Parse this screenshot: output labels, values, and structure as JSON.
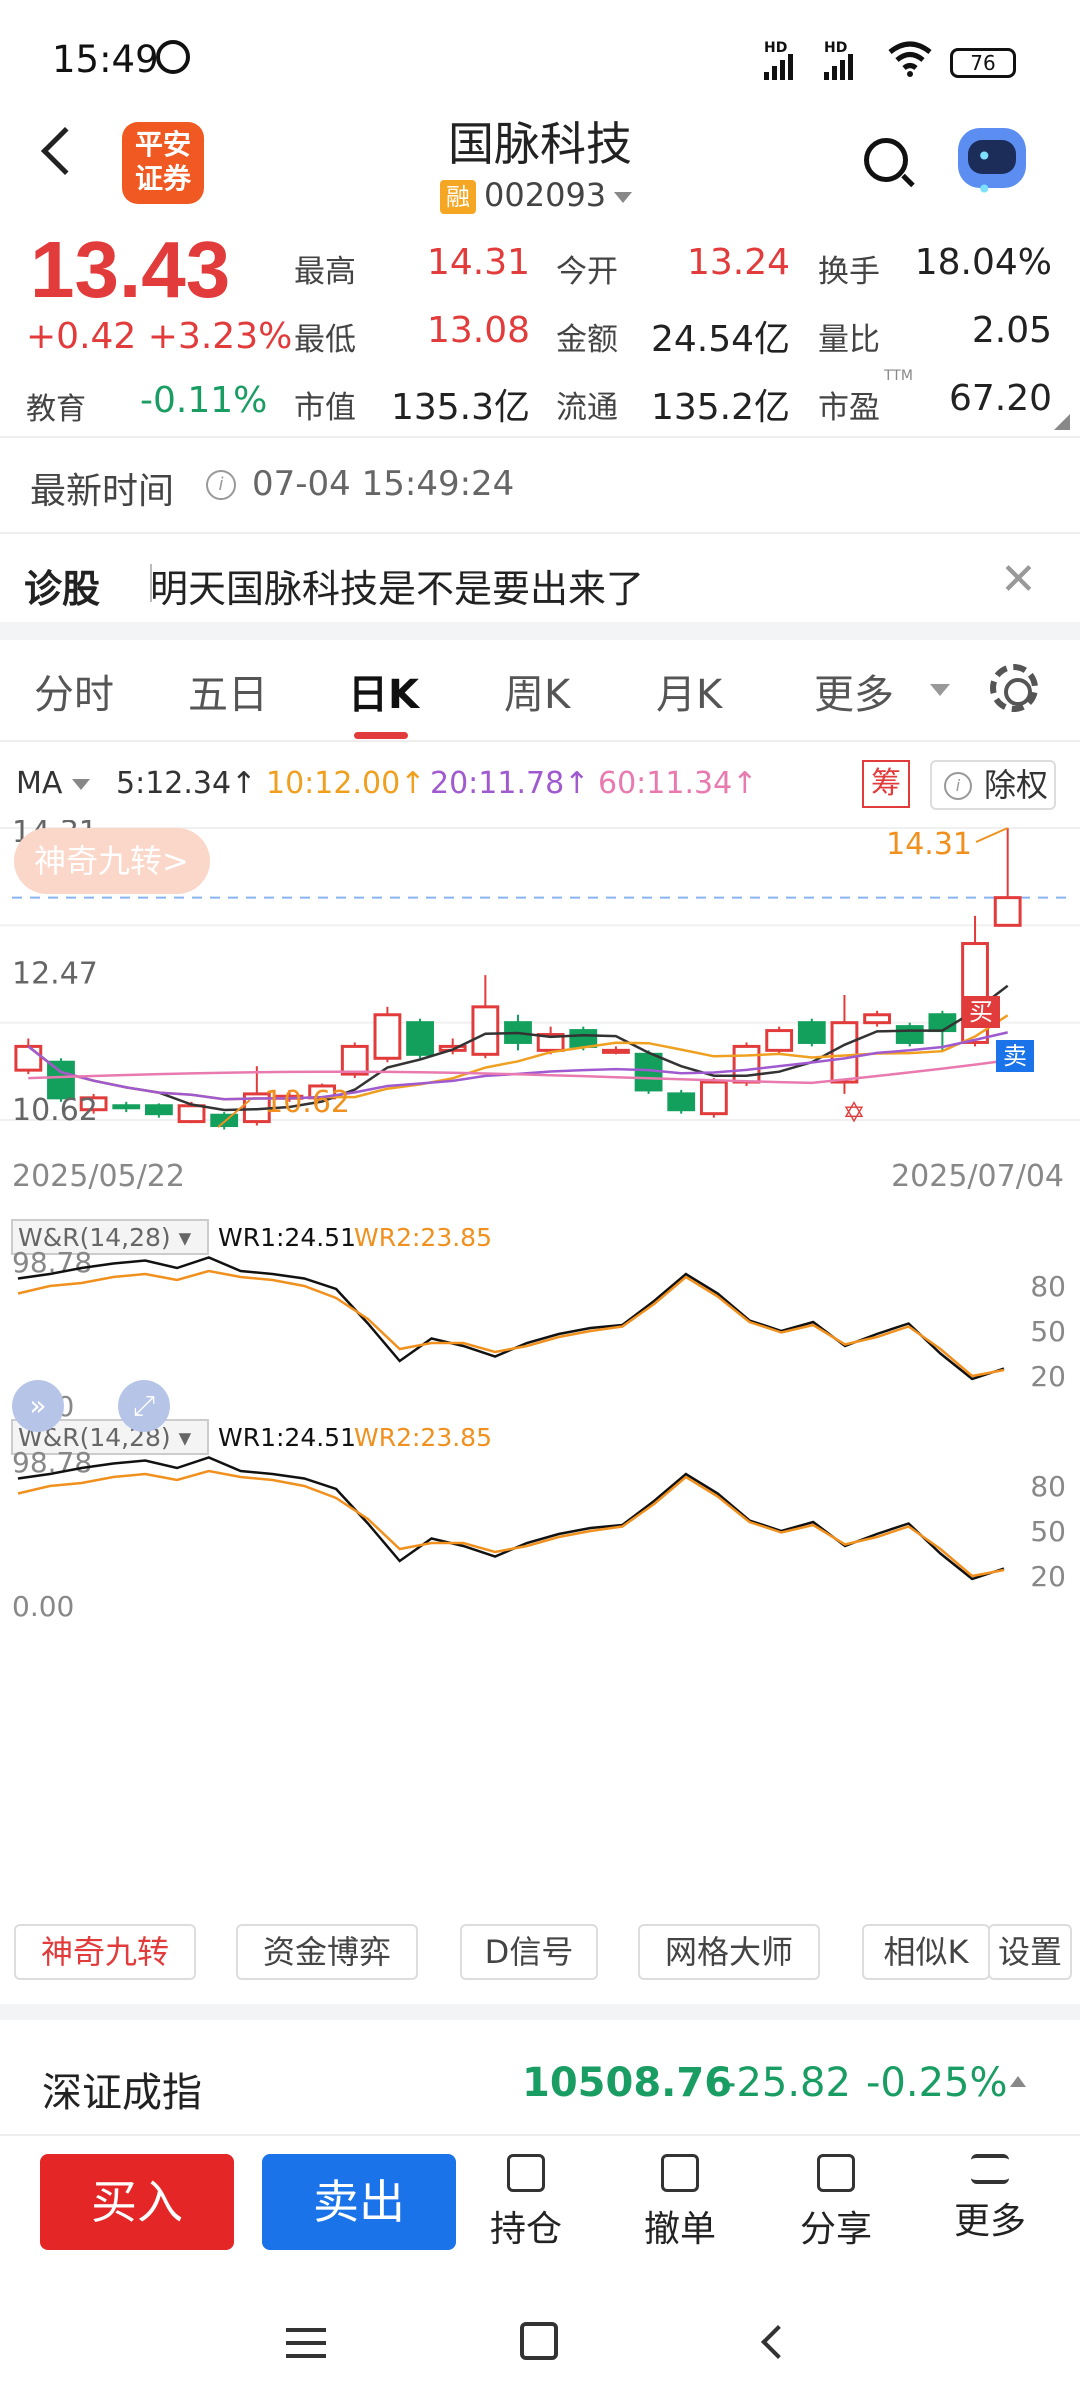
{
  "status_bar": {
    "time": "15:49",
    "battery": "76",
    "hd1": "HD",
    "hd2": "HD"
  },
  "header": {
    "logo_line1": "平安",
    "logo_line2": "证券",
    "stock_name": "国脉科技",
    "rong_badge": "融",
    "stock_code": "002093"
  },
  "quote": {
    "price": "13.43",
    "change": "+0.42",
    "change_pct": "+3.23%",
    "sector_name": "教育",
    "sector_pct": "-0.11%",
    "fields": [
      {
        "label": "最高",
        "value": "14.31",
        "color": "#e23b3b"
      },
      {
        "label": "今开",
        "value": "13.24",
        "color": "#e23b3b"
      },
      {
        "label": "换手",
        "value": "18.04%",
        "color": "#222222"
      },
      {
        "label": "最低",
        "value": "13.08",
        "color": "#e23b3b"
      },
      {
        "label": "金额",
        "value": "24.54亿",
        "color": "#222222"
      },
      {
        "label": "量比",
        "value": "2.05",
        "color": "#222222"
      },
      {
        "label": "市值",
        "value": "135.3亿",
        "color": "#222222"
      },
      {
        "label": "流通",
        "value": "135.2亿",
        "color": "#222222"
      },
      {
        "label": "市盈",
        "value": "67.20",
        "color": "#222222"
      }
    ],
    "ttm": "TTM"
  },
  "latest_time": {
    "label": "最新时间",
    "value": "07-04 15:49:24"
  },
  "diagnosis": {
    "label": "诊股",
    "text": "明天国脉科技是不是要出来了"
  },
  "tabs": [
    "分时",
    "五日",
    "日K",
    "周K",
    "月K",
    "更多"
  ],
  "ma": {
    "label": "MA",
    "items": [
      {
        "text": "5:12.34↑",
        "color": "#333333"
      },
      {
        "text": "10:12.00↑",
        "color": "#f0a020"
      },
      {
        "text": "20:11.78↑",
        "color": "#a05ad0"
      },
      {
        "text": "60:11.34↑",
        "color": "#e87ab0"
      }
    ],
    "chou": "筹",
    "chuquan": "除权"
  },
  "chart_data": [
    {
      "type": "candlestick",
      "title": "日K",
      "y_labels": [
        "14.31",
        "12.47",
        "10.62"
      ],
      "max_label": "14.31",
      "min_label": "10.62",
      "x_start": "2025/05/22",
      "x_end": "2025/07/04",
      "ylim": [
        10.62,
        14.31
      ],
      "candles": [
        {
          "o": 11.25,
          "c": 11.55,
          "h": 11.65,
          "l": 11.2
        },
        {
          "o": 11.35,
          "c": 10.9,
          "h": 11.4,
          "l": 10.85
        },
        {
          "o": 10.75,
          "c": 10.9,
          "h": 10.95,
          "l": 10.7
        },
        {
          "o": 10.8,
          "c": 10.78,
          "h": 10.85,
          "l": 10.72
        },
        {
          "o": 10.8,
          "c": 10.7,
          "h": 10.83,
          "l": 10.65
        },
        {
          "o": 10.6,
          "c": 10.8,
          "h": 10.85,
          "l": 10.58
        },
        {
          "o": 10.68,
          "c": 10.55,
          "h": 10.72,
          "l": 10.5
        },
        {
          "o": 10.6,
          "c": 10.95,
          "h": 11.3,
          "l": 10.55
        },
        {
          "o": 10.9,
          "c": 10.92,
          "h": 11.0,
          "l": 10.85
        },
        {
          "o": 10.9,
          "c": 11.05,
          "h": 11.08,
          "l": 10.88
        },
        {
          "o": 11.2,
          "c": 11.55,
          "h": 11.6,
          "l": 11.15
        },
        {
          "o": 11.4,
          "c": 11.95,
          "h": 12.05,
          "l": 11.35
        },
        {
          "o": 11.85,
          "c": 11.45,
          "h": 11.9,
          "l": 11.4
        },
        {
          "o": 11.5,
          "c": 11.55,
          "h": 11.65,
          "l": 11.45
        },
        {
          "o": 11.45,
          "c": 12.05,
          "h": 12.45,
          "l": 11.4
        },
        {
          "o": 11.85,
          "c": 11.6,
          "h": 11.95,
          "l": 11.5
        },
        {
          "o": 11.5,
          "c": 11.7,
          "h": 11.8,
          "l": 11.45
        },
        {
          "o": 11.75,
          "c": 11.55,
          "h": 11.8,
          "l": 11.5
        },
        {
          "o": 11.5,
          "c": 11.5,
          "h": 11.55,
          "l": 11.45
        },
        {
          "o": 11.45,
          "c": 11.0,
          "h": 11.5,
          "l": 10.95
        },
        {
          "o": 10.95,
          "c": 10.75,
          "h": 11.0,
          "l": 10.7
        },
        {
          "o": 10.7,
          "c": 11.1,
          "h": 11.15,
          "l": 10.65
        },
        {
          "o": 11.1,
          "c": 11.55,
          "h": 11.6,
          "l": 11.05
        },
        {
          "o": 11.5,
          "c": 11.75,
          "h": 11.8,
          "l": 11.45
        },
        {
          "o": 11.85,
          "c": 11.6,
          "h": 11.9,
          "l": 11.55
        },
        {
          "o": 11.1,
          "c": 11.85,
          "h": 12.2,
          "l": 10.95
        },
        {
          "o": 11.85,
          "c": 11.95,
          "h": 12.0,
          "l": 11.8
        },
        {
          "o": 11.8,
          "c": 11.6,
          "h": 11.85,
          "l": 11.55
        },
        {
          "o": 11.95,
          "c": 11.75,
          "h": 12.0,
          "l": 11.5
        },
        {
          "o": 11.6,
          "c": 12.85,
          "h": 13.2,
          "l": 11.55
        },
        {
          "o": 13.08,
          "c": 13.43,
          "h": 14.31,
          "l": 13.08
        }
      ]
    },
    {
      "type": "line",
      "title": "W&R(14,28)",
      "series": [
        {
          "name": "WR1:24.51",
          "color": "#111111"
        },
        {
          "name": "WR2:23.85",
          "color": "#f0901e"
        }
      ],
      "y_left_labels": [
        "98.78",
        "0.00"
      ],
      "y_right_labels": [
        "80",
        "50",
        "20"
      ],
      "ylim": [
        0,
        100
      ]
    },
    {
      "type": "line",
      "title": "W&R(14,28)",
      "series": [
        {
          "name": "WR1:24.51",
          "color": "#111111"
        },
        {
          "name": "WR2:23.85",
          "color": "#f0901e"
        }
      ],
      "y_left_labels": [
        "98.78",
        "0.00"
      ],
      "y_right_labels": [
        "80",
        "50",
        "20"
      ],
      "ylim": [
        0,
        100
      ]
    }
  ],
  "chart_overlay": {
    "shenqi": "神奇九转>",
    "buy_marker": "买",
    "sell_marker": "卖"
  },
  "tools": [
    "神奇九转",
    "资金博弈",
    "D信号",
    "网格大师",
    "相似K",
    "设置"
  ],
  "index": {
    "name": "深证成指",
    "value": "10508.76",
    "change": "-25.82",
    "change_pct": "-0.25%"
  },
  "bottom_bar": {
    "buy": "买入",
    "sell": "卖出",
    "items": [
      "持仓",
      "撤单",
      "分享",
      "更多"
    ]
  }
}
